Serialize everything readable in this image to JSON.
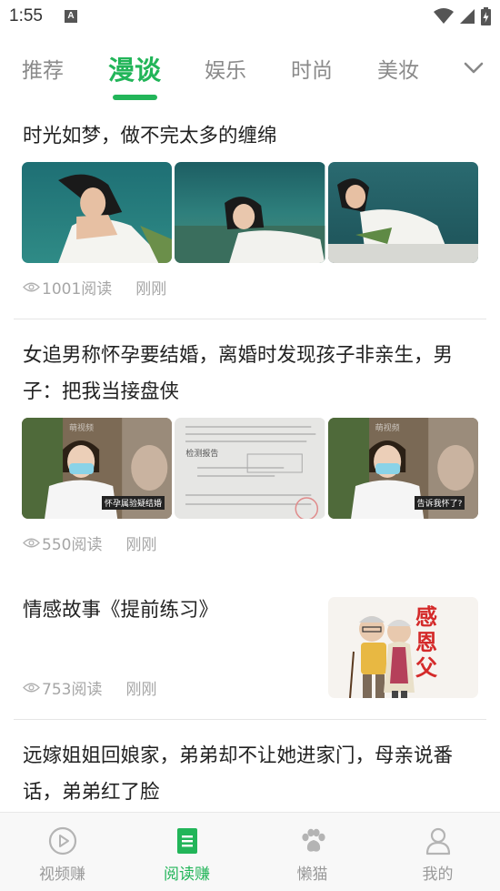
{
  "status_bar": {
    "time": "1:55",
    "notification_icon": "A"
  },
  "tabs": {
    "items": [
      {
        "label": "推荐"
      },
      {
        "label": "漫谈"
      },
      {
        "label": "娱乐"
      },
      {
        "label": "时尚"
      },
      {
        "label": "美妆"
      }
    ],
    "active_index": 1,
    "accent_color": "#22b559"
  },
  "articles": [
    {
      "title": "时光如梦，做不完太多的缠绵",
      "reads": "1001阅读",
      "time": "刚刚"
    },
    {
      "title": "女追男称怀孕要结婚，离婚时发现孩子非亲生，男子：把我当接盘侠",
      "reads": "550阅读",
      "time": "刚刚",
      "thumb_captions": [
        "怀孕属验疑结婚",
        "告诉我怀了?"
      ],
      "doc_label": "检测报告",
      "watermark": "萌视频"
    },
    {
      "title": "情感故事《提前练习》",
      "reads": "753阅读",
      "time": "刚刚",
      "thumb_text": "感恩父"
    },
    {
      "title": "远嫁姐姐回娘家，弟弟却不让她进家门，母亲说番话，弟弟红了脸"
    }
  ],
  "bottom_nav": {
    "items": [
      {
        "label": "视频赚",
        "icon": "play-circle-icon"
      },
      {
        "label": "阅读赚",
        "icon": "document-icon"
      },
      {
        "label": "懒猫",
        "icon": "paw-icon"
      },
      {
        "label": "我的",
        "icon": "person-icon"
      }
    ],
    "active_index": 1
  }
}
